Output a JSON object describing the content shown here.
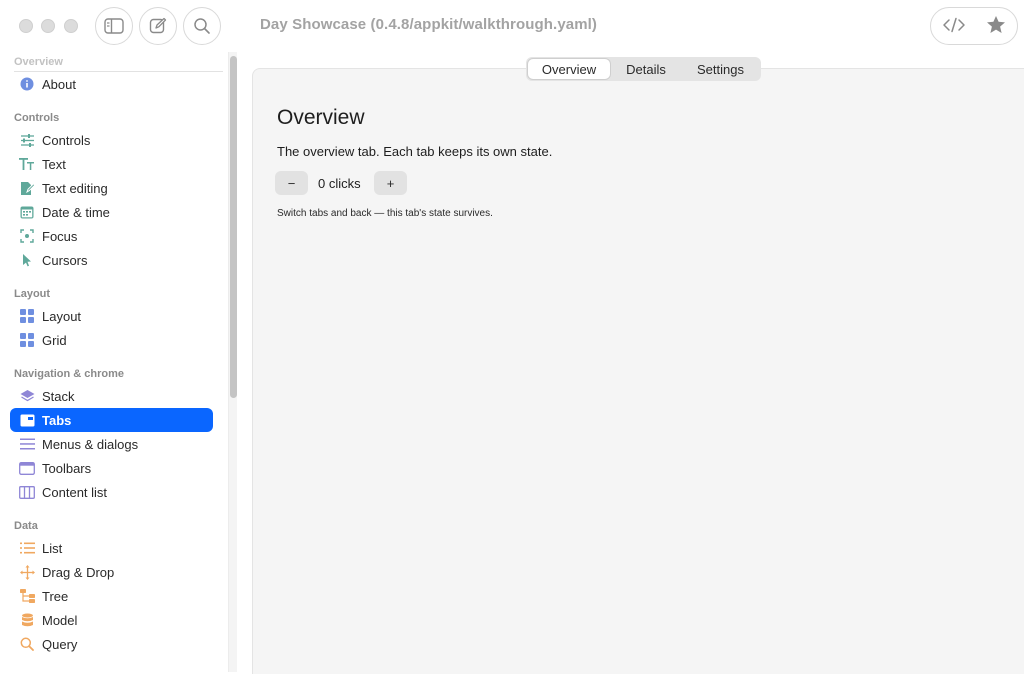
{
  "window": {
    "title": "Day Showcase (0.4.8/appkit/walkthrough.yaml)"
  },
  "toolbar": {
    "left_buttons": [
      "sidebar-toggle-icon",
      "compose-icon",
      "search-icon"
    ],
    "right_buttons": [
      "code-icon",
      "star-icon"
    ]
  },
  "sidebar": {
    "top_section": "Overview",
    "about_label": "About",
    "sections": [
      {
        "title": "Controls",
        "items": [
          "Controls",
          "Text",
          "Text editing",
          "Date & time",
          "Focus",
          "Cursors"
        ]
      },
      {
        "title": "Layout",
        "items": [
          "Layout",
          "Grid"
        ]
      },
      {
        "title": "Navigation & chrome",
        "items": [
          "Stack",
          "Tabs",
          "Menus & dialogs",
          "Toolbars",
          "Content list"
        ]
      },
      {
        "title": "Data",
        "items": [
          "List",
          "Drag & Drop",
          "Tree",
          "Model",
          "Query"
        ]
      }
    ],
    "selected_item": "Tabs"
  },
  "tabs": {
    "items": [
      "Overview",
      "Details",
      "Settings"
    ],
    "active": "Overview"
  },
  "main": {
    "heading": "Overview",
    "description": "The overview tab. Each tab keeps its own state.",
    "minus_label": "−",
    "plus_label": "+",
    "clicks_text": "0 clicks",
    "hint": "Switch tabs and back — this tab's state survives."
  },
  "colors": {
    "accent": "#0a66ff",
    "info_icon": "#6f8fe0",
    "controls_icons": "#5fa89a",
    "layout_icons": "#6f8fe0",
    "navigation_icons": "#8f86d6",
    "data_icons": "#f0a860"
  }
}
